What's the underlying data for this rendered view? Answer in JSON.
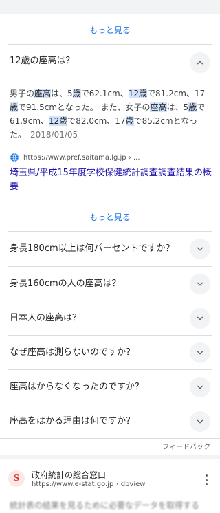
{
  "top_more_label": "もっと見る",
  "expanded_question": {
    "title": "12歳の座高は？",
    "answer_parts": [
      {
        "t": "男子の",
        "h": false
      },
      {
        "t": "座高",
        "h": true
      },
      {
        "t": "は、5",
        "h": false
      },
      {
        "t": "歳",
        "h": true
      },
      {
        "t": "で62.1cm、",
        "h": false
      },
      {
        "t": "12歳",
        "h": true
      },
      {
        "t": "で81.2cm、17",
        "h": false
      },
      {
        "t": "歳",
        "h": true
      },
      {
        "t": "で91.5cmとなった。 また、女子の",
        "h": false
      },
      {
        "t": "座高",
        "h": true
      },
      {
        "t": "は、5",
        "h": false
      },
      {
        "t": "歳",
        "h": true
      },
      {
        "t": "で61.9cm、",
        "h": false
      },
      {
        "t": "12歳",
        "h": true
      },
      {
        "t": "で82.0cm、17",
        "h": false
      },
      {
        "t": "歳",
        "h": true
      },
      {
        "t": "で85.2cmとなった。",
        "h": false
      }
    ],
    "date": "2018/01/05",
    "source_url": "https://www.pref.saitama.lg.jp › ...",
    "source_title": "埼玉県/平成15年度学校保健統計調査調査結果の概要",
    "icons": {
      "source": "globe-icon",
      "toggle": "chevron-up-icon"
    }
  },
  "second_more_label": "もっと見る",
  "questions": [
    "身長180cm以上は何パーセントですか？",
    "身長160cmの人の座高は？",
    "日本人の座高は？",
    "なぜ座高は測らないのですか？",
    "座高はからなくなったのですか？",
    "座高をはかる理由は何ですか？"
  ],
  "feedback_label": "フィードバック",
  "result": {
    "favicon_letter": "S",
    "site_name": "政府統計の総合窓口",
    "url": "https://www.e-stat.go.jp › dbview",
    "snippet_partial": "統計表の結果を見るために必要なデータを取得する"
  },
  "colors": {
    "link": "#1a0dab",
    "accent": "#1a73e8",
    "highlight": "#d2e3fc"
  }
}
